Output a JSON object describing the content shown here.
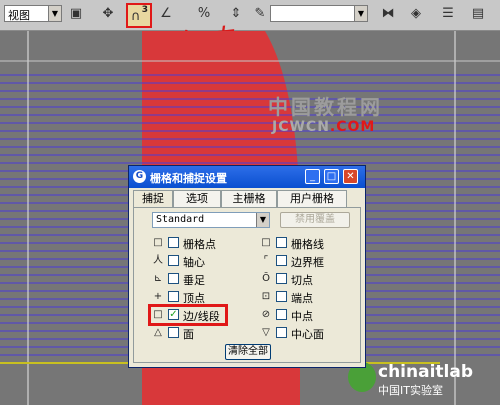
{
  "toolbar": {
    "view_combo_value": "视图",
    "snap_superscript": "3",
    "handwritten_note": "右击"
  },
  "watermark": {
    "site_cn": "中国教程网",
    "site_url_prefix": "JCWCN",
    "site_url_suffix": ".COM",
    "logo_name": "chinaitlab",
    "logo_sub": "中国IT实验室"
  },
  "dialog": {
    "title": "栅格和捕捉设置",
    "tabs": [
      {
        "label": "捕捉"
      },
      {
        "label": "选项"
      },
      {
        "label": "主栅格"
      },
      {
        "label": "用户栅格"
      }
    ],
    "preset_combo": "Standard",
    "override_button": "禁用覆盖",
    "options_left": [
      {
        "label": "栅格点",
        "checked": false,
        "icon": "grid-point-icon"
      },
      {
        "label": "轴心",
        "checked": false,
        "icon": "pivot-icon"
      },
      {
        "label": "垂足",
        "checked": false,
        "icon": "perpendicular-icon"
      },
      {
        "label": "顶点",
        "checked": false,
        "icon": "vertex-icon"
      },
      {
        "label": "边/线段",
        "checked": true,
        "icon": "edge-icon"
      },
      {
        "label": "面",
        "checked": false,
        "icon": "face-icon"
      }
    ],
    "options_right": [
      {
        "label": "栅格线",
        "checked": false,
        "icon": "grid-line-icon"
      },
      {
        "label": "边界框",
        "checked": false,
        "icon": "bounding-box-icon"
      },
      {
        "label": "切点",
        "checked": false,
        "icon": "tangent-icon"
      },
      {
        "label": "端点",
        "checked": false,
        "icon": "endpoint-icon"
      },
      {
        "label": "中点",
        "checked": false,
        "icon": "midpoint-icon"
      },
      {
        "label": "中心面",
        "checked": false,
        "icon": "center-face-icon"
      }
    ],
    "clear_button": "清除全部"
  }
}
